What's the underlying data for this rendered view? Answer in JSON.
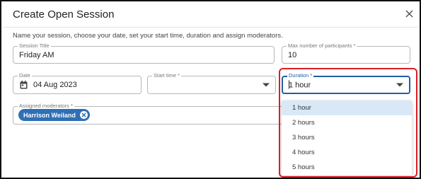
{
  "dialog": {
    "title": "Create Open Session",
    "description": "Name your session, choose your date, set your start time, duration and assign moderators."
  },
  "fields": {
    "session_title": {
      "label": "Session Title",
      "value": "Friday AM"
    },
    "max_participants": {
      "label": "Max number of participants *",
      "value": "10"
    },
    "date": {
      "label": "Date",
      "value": "04 Aug 2023"
    },
    "start_time": {
      "label": "Start time *",
      "value": ""
    },
    "duration": {
      "label": "Duration *",
      "value": "1 hour"
    },
    "moderators": {
      "label": "Assigned moderators *",
      "chips": [
        "Harrison Weiland"
      ]
    }
  },
  "duration_options": [
    {
      "label": "1 hour",
      "selected": true
    },
    {
      "label": "2 hours",
      "selected": false
    },
    {
      "label": "3 hours",
      "selected": false
    },
    {
      "label": "4 hours",
      "selected": false
    },
    {
      "label": "5 hours",
      "selected": false
    }
  ],
  "colors": {
    "chip": "#2f6fb5",
    "highlight": "#d91f26",
    "focus": "#1f5fa8",
    "selected_option": "#d8e8f7"
  },
  "icons": [
    "close-icon",
    "calendar-icon",
    "chevron-down-icon",
    "chip-remove-icon"
  ]
}
